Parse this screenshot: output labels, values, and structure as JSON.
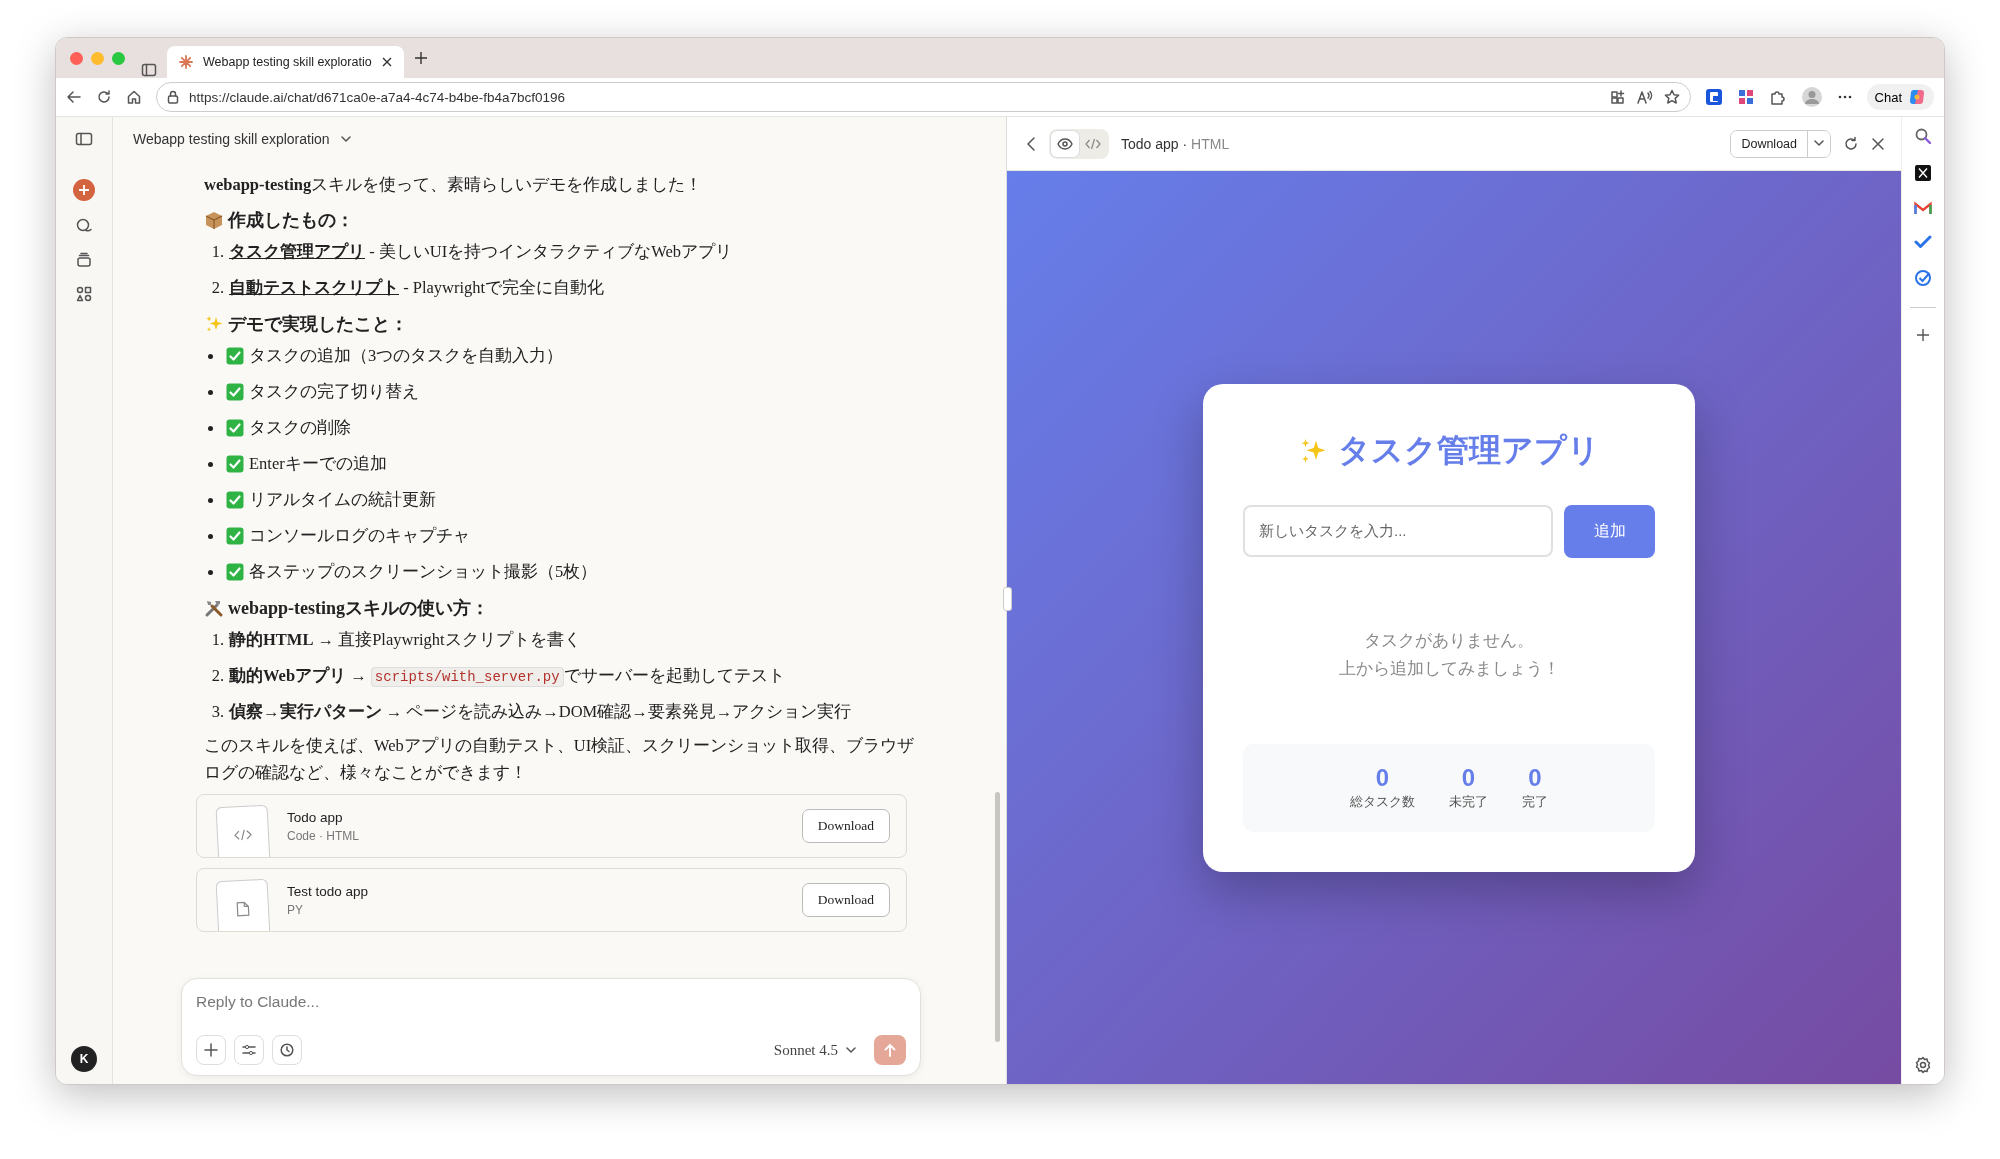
{
  "browser": {
    "tabs": [
      {
        "title": "Webapp testing skill exploratio",
        "selected": true
      }
    ],
    "url": "https://claude.ai/chat/d671ca0e-a7a4-4c74-b4be-fb4a7bcf0196",
    "chat_button": "Chat"
  },
  "chat": {
    "title": "Webapp testing skill exploration",
    "avatar": "K",
    "blocks": [
      {
        "kind": "paragraph",
        "parts": [
          {
            "kind": "bold",
            "text": "webapp-testing"
          },
          {
            "kind": "text",
            "text": "スキルを使って、素晴らしいデモを作成しました！"
          }
        ]
      },
      {
        "kind": "heading",
        "text": "作成したもの："
      },
      {
        "kind": "numbered",
        "items": [
          {
            "number": "1.",
            "parts": [
              {
                "kind": "link",
                "text": "タスク管理アプリ"
              },
              {
                "kind": "text",
                "text": " - 美しいUIを持つインタラクティブなWebアプリ"
              }
            ]
          },
          {
            "number": "2.",
            "parts": [
              {
                "kind": "link",
                "text": "自動テストスクリプト"
              },
              {
                "kind": "text",
                "text": " - Playwrightで完全に自動化"
              }
            ]
          }
        ]
      },
      {
        "kind": "heading",
        "text": "デモで実現したこと："
      },
      {
        "kind": "checklist",
        "items": [
          "タスクの追加（3つのタスクを自動入力）",
          "タスクの完了切り替え",
          "タスクの削除",
          "Enterキーでの追加",
          "リアルタイムの統計更新",
          "コンソールログのキャプチャ",
          "各ステップのスクリーンショット撮影（5枚）"
        ]
      },
      {
        "kind": "heading",
        "text": "webapp-testingスキルの使い方："
      },
      {
        "kind": "numbered",
        "items": [
          {
            "number": "1.",
            "parts": [
              {
                "kind": "bold",
                "text": "静的HTML"
              },
              {
                "kind": "text",
                "text": " → 直接Playwrightスクリプトを書く"
              }
            ]
          },
          {
            "number": "2.",
            "parts": [
              {
                "kind": "bold",
                "text": "動的Webアプリ"
              },
              {
                "kind": "text",
                "text": " → "
              },
              {
                "kind": "code",
                "text": "scripts/with_server.py"
              },
              {
                "kind": "text",
                "text": "でサーバーを起動してテスト"
              }
            ]
          },
          {
            "number": "3.",
            "parts": [
              {
                "kind": "bold",
                "text": "偵察→実行パターン"
              },
              {
                "kind": "text",
                "text": " → ページを読み込み→DOM確認→要素発見→アクション実行"
              }
            ]
          }
        ]
      },
      {
        "kind": "paragraph",
        "parts": [
          {
            "kind": "text",
            "text": "このスキルを使えば、Webアプリの自動テスト、UI検証、スクリーンショット取得、ブラウザログの確認など、様々なことができます！"
          }
        ]
      }
    ],
    "artifacts": [
      {
        "kind": "code",
        "title": "Todo app",
        "meta": "Code · HTML",
        "button": "Download"
      },
      {
        "kind": "file",
        "title": "Test todo app",
        "meta": "PY",
        "button": "Download"
      }
    ],
    "composer": {
      "placeholder": "Reply to Claude...",
      "model": "Sonnet 4.5"
    }
  },
  "preview": {
    "title": "Todo app",
    "separator": "·",
    "subtitle": "HTML",
    "download": "Download",
    "view_modes": [
      {
        "kind": "preview",
        "selected": true
      },
      {
        "kind": "code",
        "selected": false
      }
    ],
    "app": {
      "title": "タスク管理アプリ",
      "input_placeholder": "新しいタスクを入力...",
      "add_button": "追加",
      "empty_lines": [
        "タスクがありません。",
        "上から追加してみましょう！"
      ],
      "stats": [
        {
          "value": "0",
          "label": "総タスク数"
        },
        {
          "value": "0",
          "label": "未完了"
        },
        {
          "value": "0",
          "label": "完了"
        }
      ]
    }
  }
}
